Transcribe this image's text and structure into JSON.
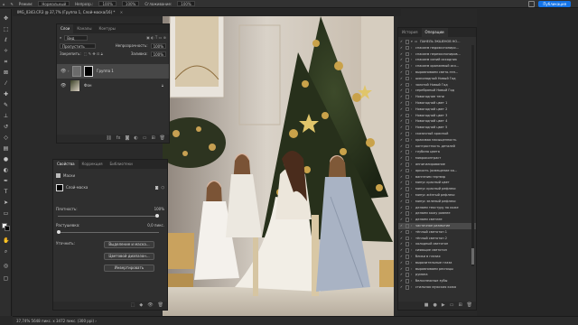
{
  "topbar": {
    "mode_label": "Режим:",
    "mode_value": "Нормальный",
    "opacity_label": "Непрозр.:",
    "opacity_value": "100%",
    "flow_value": "100%",
    "smoothing_label": "Сглаживание:",
    "smoothing_value": "100%",
    "publish_label": "Публикация"
  },
  "document": {
    "tab_title": "IMG_0343.CR3 @ 37,7% (Группа 1, Слой-маска/16) *",
    "close": "×"
  },
  "layers_panel": {
    "tabs": [
      "Слои",
      "Каналы",
      "Контуры"
    ],
    "kind_label": "Вид",
    "blend_mode": "Пропустить",
    "opacity_label": "Непрозрачность:",
    "opacity_value": "100%",
    "lock_label": "Закрепить:",
    "fill_label": "Заливка:",
    "fill_value": "100%",
    "layers": [
      {
        "name": "Группа 1"
      },
      {
        "name": "Фон"
      }
    ]
  },
  "properties_panel": {
    "tabs": [
      "Свойства",
      "Коррекция",
      "Библиотеки"
    ],
    "section_label": "Маски",
    "mask_label": "Слой-маска",
    "density_label": "Плотность:",
    "density_value": "100%",
    "feather_label": "Растушевка:",
    "feather_value": "0,0 пикс.",
    "refine_label": "Уточнить:",
    "btn_select": "Выделение и маска...",
    "btn_color_range": "Цветовой диапазон...",
    "btn_invert": "Инвертировать"
  },
  "actions_panel": {
    "tabs": [
      "История",
      "Операции"
    ],
    "items": [
      "ПАНЕЛЬ ЭКШЕНОВ НО...",
      "спасаем недоэкспониро...",
      "спасаем переэкспониров...",
      "спасаем синий исходник",
      "спасаем оранжевый исх...",
      "выравниваем свето-тен...",
      "шоколадный Новый Год",
      "золотой Новый Год",
      "серебряный Новый Год",
      "Новогодние тени",
      "Новогодний цвет 1",
      "Новогодний цвет 2",
      "Новогодний цвет 3",
      "Новогодний цвет 4",
      "Новогодний цвет 5",
      "сказочный красный",
      "красивая насыщенность",
      "контрастность деталей",
      "глубина цвета",
      "микроконтраст",
      "аннигилирование",
      "яркость (освещение ка...",
      "вангеним гертвэр",
      "минус красный цвет",
      "минус красный рефлекс",
      "минус жёлтый рефлекс",
      "минус зеленый рефлекс",
      "делаем текстуру на коже",
      "делаем кожу ровнее",
      "делаем светлее",
      "частичное размытие",
      "тёплый светотон 1",
      "тёплый светотон 2",
      "холодный светотон",
      "сияющие светотон",
      "блики в глазах",
      "выразительные глаза",
      "выравниваем ресницы",
      "румяна",
      "белоснежные зубы",
      "стильная мужская кожа"
    ],
    "selected_index": 30
  },
  "statusbar": {
    "text": "37,74%   5648 пикс. x 3472 пикс. (300 ppi)   ›"
  },
  "colors": {
    "accent": "#1473e6",
    "panel_bg": "#2f2f2f",
    "app_bg": "#282828"
  }
}
